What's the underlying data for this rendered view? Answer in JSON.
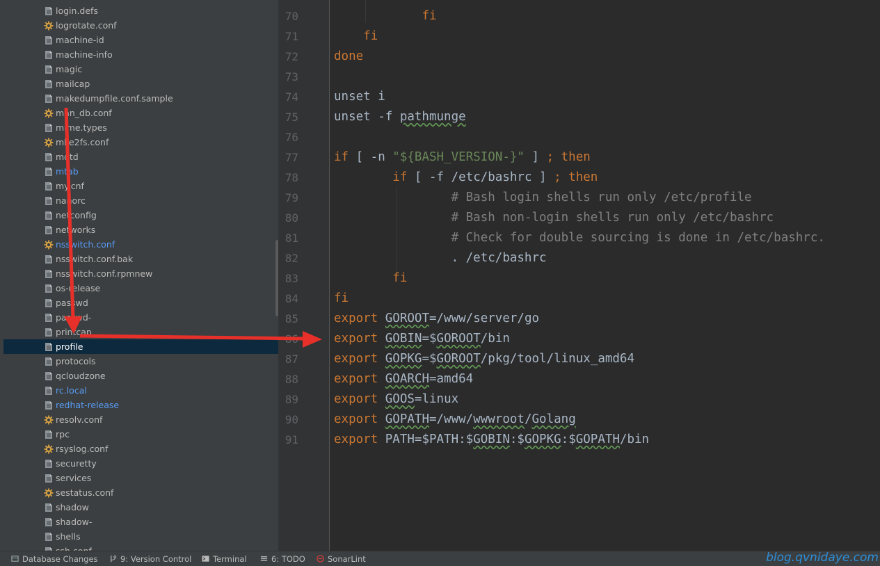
{
  "project_tree": {
    "top_partial": "login.defs",
    "files": [
      {
        "name": "login.defs",
        "icon": "text-file-icon",
        "color": "default"
      },
      {
        "name": "logrotate.conf",
        "icon": "config-gear-icon",
        "color": "default"
      },
      {
        "name": "machine-id",
        "icon": "text-file-icon",
        "color": "default"
      },
      {
        "name": "machine-info",
        "icon": "text-file-icon",
        "color": "default"
      },
      {
        "name": "magic",
        "icon": "text-file-icon",
        "color": "default"
      },
      {
        "name": "mailcap",
        "icon": "text-file-icon",
        "color": "default"
      },
      {
        "name": "makedumpfile.conf.sample",
        "icon": "text-file-icon",
        "color": "default"
      },
      {
        "name": "man_db.conf",
        "icon": "config-gear-icon",
        "color": "default"
      },
      {
        "name": "mime.types",
        "icon": "text-file-icon",
        "color": "default"
      },
      {
        "name": "mke2fs.conf",
        "icon": "config-gear-icon",
        "color": "default"
      },
      {
        "name": "motd",
        "icon": "text-file-icon",
        "color": "default"
      },
      {
        "name": "mtab",
        "icon": "text-file-icon",
        "color": "blue"
      },
      {
        "name": "my.cnf",
        "icon": "text-file-icon",
        "color": "default"
      },
      {
        "name": "nanorc",
        "icon": "text-file-icon",
        "color": "default"
      },
      {
        "name": "netconfig",
        "icon": "text-file-icon",
        "color": "default"
      },
      {
        "name": "networks",
        "icon": "text-file-icon",
        "color": "default"
      },
      {
        "name": "nsswitch.conf",
        "icon": "config-gear-icon",
        "color": "blue"
      },
      {
        "name": "nsswitch.conf.bak",
        "icon": "text-file-icon",
        "color": "default"
      },
      {
        "name": "nsswitch.conf.rpmnew",
        "icon": "text-file-icon",
        "color": "default"
      },
      {
        "name": "os-release",
        "icon": "text-file-icon",
        "color": "default"
      },
      {
        "name": "passwd",
        "icon": "text-file-icon",
        "color": "default"
      },
      {
        "name": "passwd-",
        "icon": "text-file-icon",
        "color": "default"
      },
      {
        "name": "printcap",
        "icon": "text-file-icon",
        "color": "default"
      },
      {
        "name": "profile",
        "icon": "text-file-icon",
        "color": "selected"
      },
      {
        "name": "protocols",
        "icon": "text-file-icon",
        "color": "default"
      },
      {
        "name": "qcloudzone",
        "icon": "text-file-icon",
        "color": "default"
      },
      {
        "name": "rc.local",
        "icon": "text-file-icon",
        "color": "blue"
      },
      {
        "name": "redhat-release",
        "icon": "text-file-icon",
        "color": "blue"
      },
      {
        "name": "resolv.conf",
        "icon": "config-gear-icon",
        "color": "default"
      },
      {
        "name": "rpc",
        "icon": "text-file-icon",
        "color": "default"
      },
      {
        "name": "rsyslog.conf",
        "icon": "config-gear-icon",
        "color": "default"
      },
      {
        "name": "securetty",
        "icon": "text-file-icon",
        "color": "default"
      },
      {
        "name": "services",
        "icon": "text-file-icon",
        "color": "default"
      },
      {
        "name": "sestatus.conf",
        "icon": "config-gear-icon",
        "color": "default"
      },
      {
        "name": "shadow",
        "icon": "text-file-icon",
        "color": "default"
      },
      {
        "name": "shadow-",
        "icon": "text-file-icon",
        "color": "default"
      },
      {
        "name": "shells",
        "icon": "text-file-icon",
        "color": "default"
      },
      {
        "name": "ssh.conf",
        "icon": "text-file-icon",
        "color": "default"
      }
    ]
  },
  "editor": {
    "line_numbers": [
      "70",
      "71",
      "72",
      "73",
      "74",
      "75",
      "76",
      "77",
      "78",
      "79",
      "80",
      "81",
      "82",
      "83",
      "84",
      "85",
      "86",
      "87",
      "88",
      "89",
      "90",
      "91"
    ],
    "lines": [
      [
        {
          "t": "            ",
          "c": ""
        },
        {
          "t": "fi",
          "c": "kw"
        }
      ],
      [
        {
          "t": "    ",
          "c": ""
        },
        {
          "t": "fi",
          "c": "kw"
        }
      ],
      [
        {
          "t": "done",
          "c": "kw"
        }
      ],
      [],
      [
        {
          "t": "unset i",
          "c": ""
        }
      ],
      [
        {
          "t": "unset -f ",
          "c": ""
        },
        {
          "t": "pathmunge",
          "c": "wavy"
        }
      ],
      [],
      [
        {
          "t": "if",
          "c": "kw"
        },
        {
          "t": " [ -n ",
          "c": ""
        },
        {
          "t": "\"${BASH_VERSION-}\"",
          "c": "str"
        },
        {
          "t": " ] ",
          "c": ""
        },
        {
          "t": "; then",
          "c": "kw"
        }
      ],
      [
        {
          "t": "        ",
          "c": ""
        },
        {
          "t": "if",
          "c": "kw"
        },
        {
          "t": " [ -f /etc/bashrc ] ",
          "c": ""
        },
        {
          "t": "; then",
          "c": "kw"
        }
      ],
      [
        {
          "t": "                ",
          "c": ""
        },
        {
          "t": "# Bash login shells run only /etc/profile",
          "c": "cm"
        }
      ],
      [
        {
          "t": "                ",
          "c": ""
        },
        {
          "t": "# Bash non-login shells run only /etc/bashrc",
          "c": "cm"
        }
      ],
      [
        {
          "t": "                ",
          "c": ""
        },
        {
          "t": "# Check for double sourcing is done in /etc/bashrc.",
          "c": "cm"
        }
      ],
      [
        {
          "t": "                . /etc/bashrc",
          "c": ""
        }
      ],
      [
        {
          "t": "        ",
          "c": ""
        },
        {
          "t": "fi",
          "c": "kw"
        }
      ],
      [
        {
          "t": "fi",
          "c": "kw"
        }
      ],
      [
        {
          "t": "export ",
          "c": "kw"
        },
        {
          "t": "GOROOT",
          "c": "wavy"
        },
        {
          "t": "=/www/server/go",
          "c": ""
        }
      ],
      [
        {
          "t": "export ",
          "c": "kw"
        },
        {
          "t": "GOBIN",
          "c": "wavy"
        },
        {
          "t": "=$",
          "c": ""
        },
        {
          "t": "GOROOT",
          "c": "wavy"
        },
        {
          "t": "/bin",
          "c": ""
        }
      ],
      [
        {
          "t": "export ",
          "c": "kw"
        },
        {
          "t": "GOPKG",
          "c": "wavy"
        },
        {
          "t": "=$",
          "c": ""
        },
        {
          "t": "GOROOT",
          "c": "wavy"
        },
        {
          "t": "/pkg/tool/linux_amd64",
          "c": ""
        }
      ],
      [
        {
          "t": "export ",
          "c": "kw"
        },
        {
          "t": "GOARCH",
          "c": "wavy"
        },
        {
          "t": "=amd64",
          "c": ""
        }
      ],
      [
        {
          "t": "export ",
          "c": "kw"
        },
        {
          "t": "GOOS",
          "c": "wavy"
        },
        {
          "t": "=linux",
          "c": ""
        }
      ],
      [
        {
          "t": "export ",
          "c": "kw"
        },
        {
          "t": "GOPATH",
          "c": "wavy"
        },
        {
          "t": "=/www/",
          "c": ""
        },
        {
          "t": "wwwroot",
          "c": "wavy"
        },
        {
          "t": "/",
          "c": ""
        },
        {
          "t": "Golang",
          "c": "wavy"
        }
      ],
      [
        {
          "t": "export ",
          "c": "kw"
        },
        {
          "t": "PATH=$PATH:$",
          "c": ""
        },
        {
          "t": "GOBIN",
          "c": "wavy"
        },
        {
          "t": ":$",
          "c": ""
        },
        {
          "t": "GOPKG",
          "c": "wavy"
        },
        {
          "t": ":$",
          "c": ""
        },
        {
          "t": "GOPATH",
          "c": "wavy"
        },
        {
          "t": "/bin",
          "c": ""
        }
      ]
    ]
  },
  "statusbar": {
    "database_changes": "Database Changes",
    "version_control": "9: Version Control",
    "terminal": "Terminal",
    "todo": "6: TODO",
    "sonarlint": "SonarLint"
  },
  "watermark": "blog.qvnidaye.com",
  "colors": {
    "annotation_arrow": "#e8302a",
    "keyword": "#cc7832",
    "string": "#6a8759",
    "comment": "#808080",
    "plain": "#a9b7c6",
    "selection": "#0d293e",
    "link_file": "#589df6"
  }
}
